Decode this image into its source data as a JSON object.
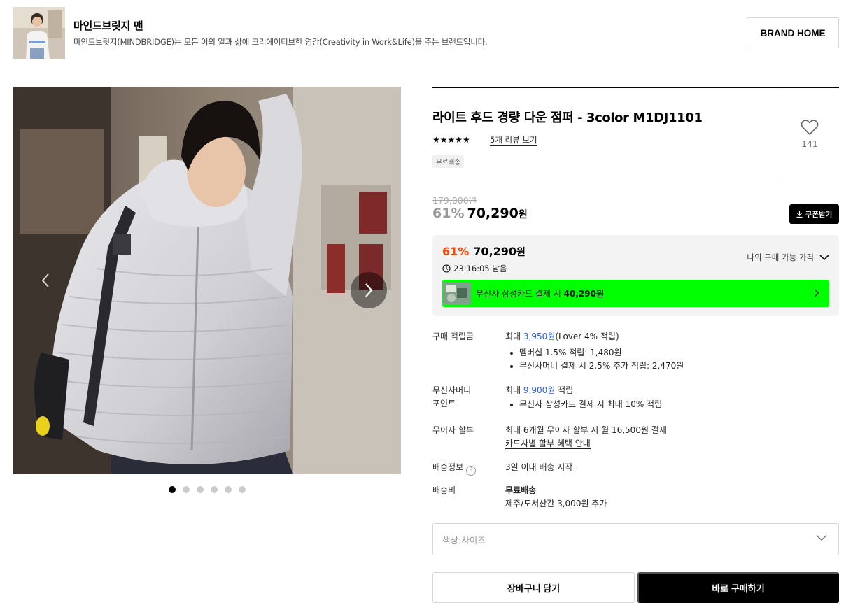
{
  "brand": {
    "name": "마인드브릿지 맨",
    "description": "마인드브릿지(MINDBRIDGE)는 모든 이의 일과 삶에 크리에이티브한 영감(Creativity in Work&Life)을 주는 브랜드입니다.",
    "home_button": "BRAND HOME"
  },
  "gallery": {
    "image_count": 6,
    "active_index": 0
  },
  "product": {
    "title": "라이트 후드 경량 다운 점퍼 - 3color M1DJ1101",
    "rating_stars": "★★★★★",
    "review_link": "5개 리뷰 보기",
    "badge": "무료배송",
    "like_count": "141"
  },
  "price": {
    "original": "179,000원",
    "discount_pct": "61%",
    "sale_price": "70,290",
    "won": "원",
    "coupon_button": "쿠폰받기"
  },
  "best_price": {
    "discount_pct": "61%",
    "price": "70,290",
    "won": "원",
    "timer": "23:16:05 남음",
    "my_price_label": "나의 구매 가능 가격",
    "card_prefix": "무신사 삼성카드 결제 시 ",
    "card_price": "40,290원"
  },
  "details": {
    "points": {
      "label": "구매 적립금",
      "max_prefix": "최대 ",
      "max_amount": "3,950원",
      "max_suffix": "(Lover 4% 적립)",
      "bullets": [
        "멤버십 1.5% 적립: 1,480원",
        "무신사머니 결제 시 2.5% 추가 적립: 2,470원"
      ]
    },
    "money_points": {
      "label_line1": "무신사머니",
      "label_line2": "포인트",
      "max_prefix": "최대 ",
      "max_amount": "9,900원",
      "max_suffix": " 적립",
      "bullets": [
        "무신사 삼성카드 결제 시 최대 10% 적립"
      ]
    },
    "installment": {
      "label": "무이자 할부",
      "line1": "최대 6개월 무이자 할부 시 월 16,500원 결제",
      "link": "카드사별 할부 혜택 안내"
    },
    "shipping_info": {
      "label": "배송정보",
      "help": "?",
      "value": "3일 이내 배송 시작"
    },
    "shipping_fee": {
      "label": "배송비",
      "value": "무료배송",
      "note": "제주/도서산간 3,000원 추가"
    }
  },
  "options": {
    "placeholder": "색상:사이즈"
  },
  "actions": {
    "cart": "장바구니 담기",
    "buy": "바로 구매하기"
  },
  "colors": {
    "discount_red": "#ff4800",
    "point_blue": "#2b60d8",
    "card_banner": "#00ff00"
  }
}
